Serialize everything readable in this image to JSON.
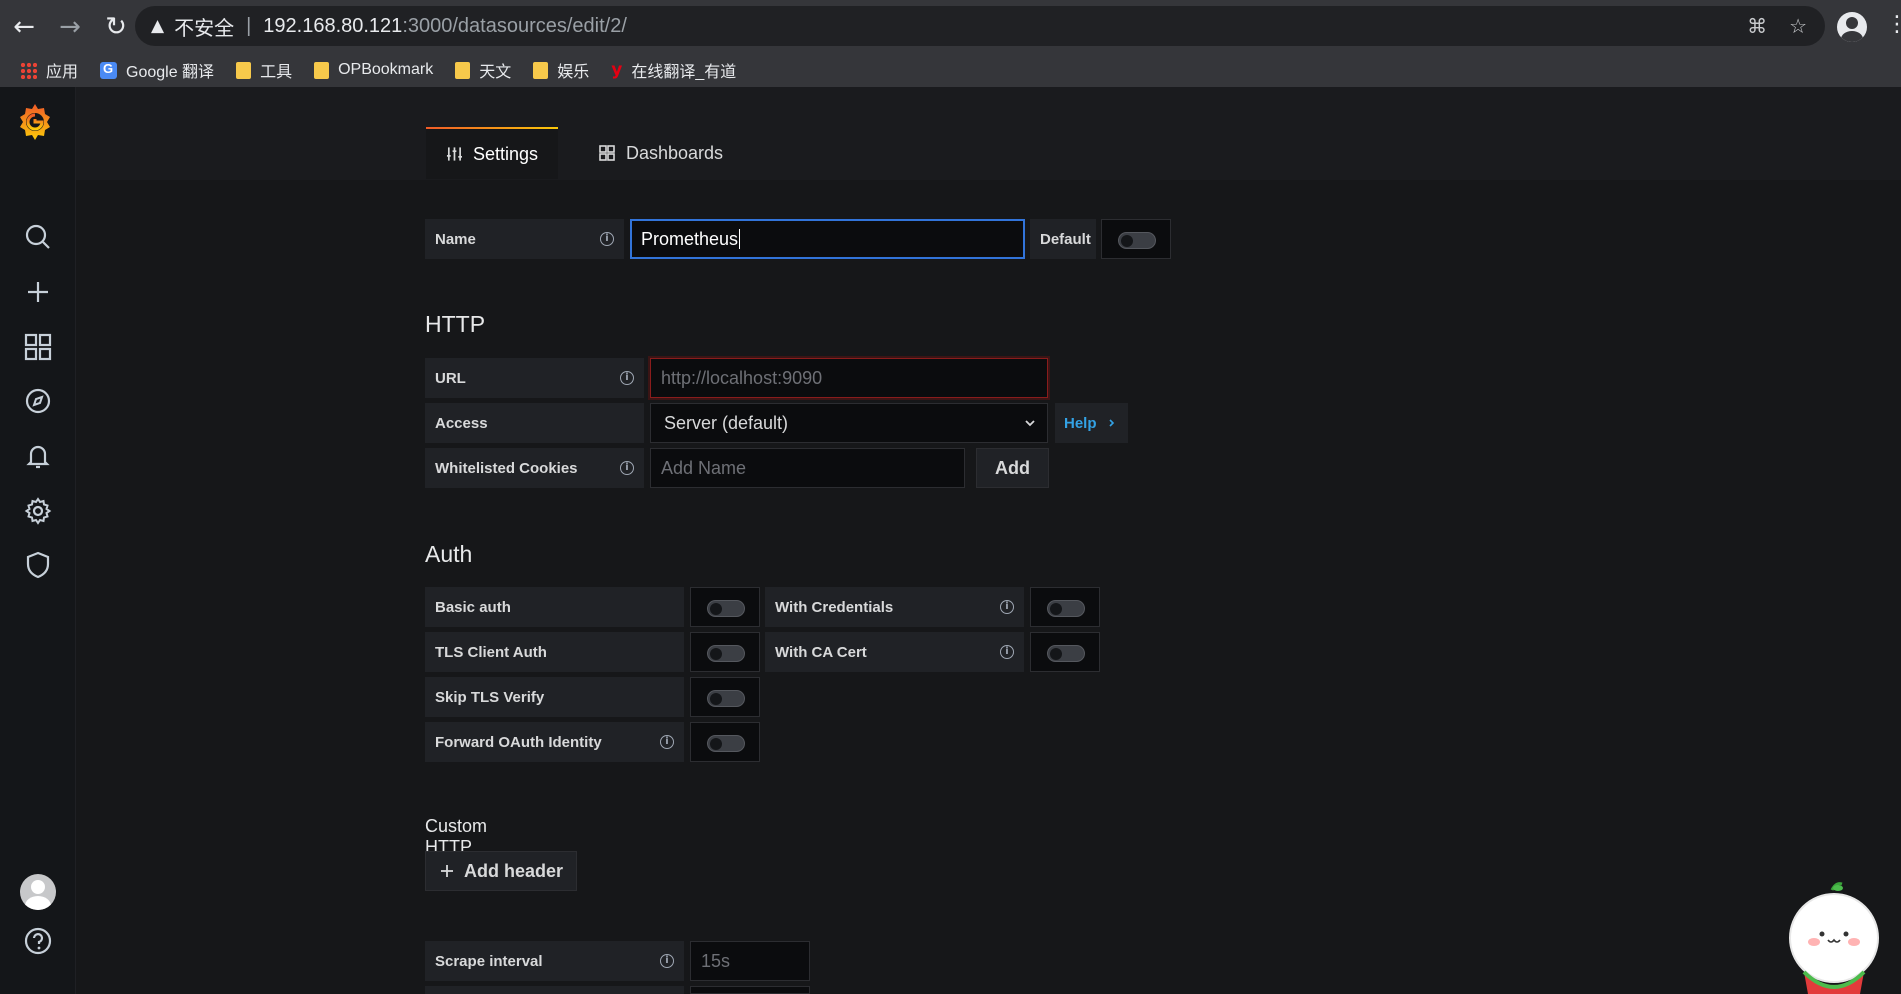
{
  "browser": {
    "insecure_label": "不安全",
    "separator": "|",
    "url_host": "192.168.80.121",
    "url_path": ":3000/datasources/edit/2/",
    "bookmarks": [
      {
        "label": "应用",
        "icon": "apps-grid-icon"
      },
      {
        "label": "Google 翻译",
        "icon": "google-translate-icon"
      },
      {
        "label": "工具",
        "icon": "folder-icon"
      },
      {
        "label": "OPBookmark",
        "icon": "folder-icon"
      },
      {
        "label": "天文",
        "icon": "folder-icon"
      },
      {
        "label": "娱乐",
        "icon": "folder-icon"
      },
      {
        "label": "在线翻译_有道",
        "icon": "youdao-icon"
      }
    ]
  },
  "tabs": {
    "settings": "Settings",
    "dashboards": "Dashboards"
  },
  "general": {
    "name_label": "Name",
    "name_value": "Prometheus",
    "default_label": "Default"
  },
  "http": {
    "title": "HTTP",
    "url_label": "URL",
    "url_placeholder": "http://localhost:9090",
    "access_label": "Access",
    "access_value": "Server (default)",
    "help_label": "Help",
    "cookies_label": "Whitelisted Cookies",
    "cookies_placeholder": "Add Name",
    "add_label": "Add"
  },
  "auth": {
    "title": "Auth",
    "basic_auth": "Basic auth",
    "with_credentials": "With Credentials",
    "tls_client_auth": "TLS Client Auth",
    "with_ca_cert": "With CA Cert",
    "skip_tls_verify": "Skip TLS Verify",
    "forward_oauth": "Forward OAuth Identity"
  },
  "headers": {
    "title": "Custom HTTP Headers",
    "add_header": "Add header"
  },
  "scrape": {
    "label": "Scrape interval",
    "placeholder": "15s"
  },
  "colors": {
    "accent_blue": "#3274d9",
    "link_blue": "#33a2e5",
    "error_red": "#8a1c1c"
  }
}
